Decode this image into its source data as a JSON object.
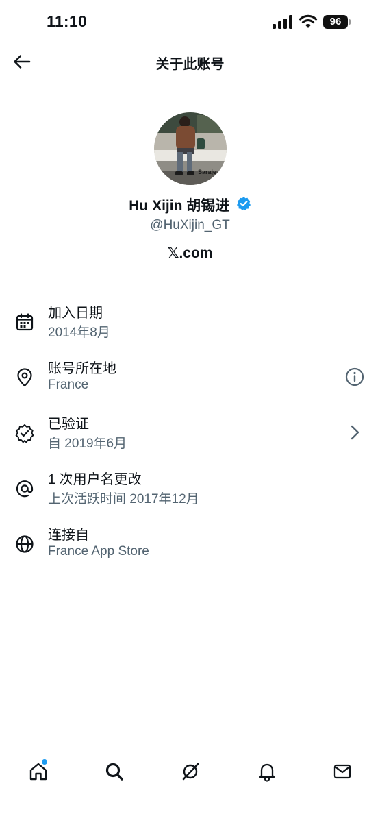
{
  "status_bar": {
    "time": "11:10",
    "battery": "96"
  },
  "header": {
    "title": "关于此账号"
  },
  "profile": {
    "display_name": "Hu Xijin 胡锡进",
    "handle": "@HuXijin_GT",
    "site": "𝕏.com",
    "avatar_caption": "Saraje"
  },
  "info_items": [
    {
      "icon": "calendar-icon",
      "title": "加入日期",
      "subtitle": "2014年8月"
    },
    {
      "icon": "location-pin-icon",
      "title": "账号所在地",
      "subtitle": "France",
      "trailing_icon": "info-icon"
    },
    {
      "icon": "verified-badge-icon",
      "title": "已验证",
      "subtitle": "自 2019年6月",
      "trailing_icon": "chevron-right-icon"
    },
    {
      "icon": "at-sign-icon",
      "title": "1 次用户名更改",
      "subtitle": "上次活跃时间 2017年12月"
    },
    {
      "icon": "globe-icon",
      "title": "连接自",
      "subtitle": "France App Store"
    }
  ],
  "tab_bar": {
    "items": [
      "home-icon",
      "search-icon",
      "grok-icon",
      "notifications-icon",
      "messages-icon"
    ]
  },
  "colors": {
    "accent": "#1d9bf0",
    "secondary_text": "#536471",
    "primary_text": "#0f1419"
  }
}
